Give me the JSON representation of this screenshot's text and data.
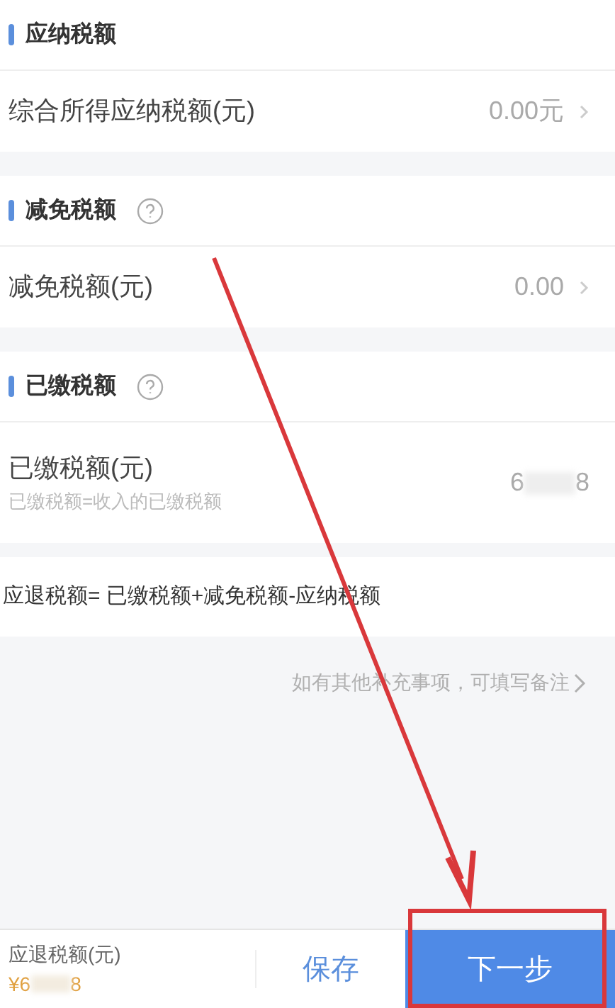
{
  "sections": [
    {
      "title": "应纳税额",
      "help": false,
      "rows": [
        {
          "label": "综合所得应纳税额(元)",
          "value": "0.00元",
          "chevron": true
        }
      ]
    },
    {
      "title": "减免税额",
      "help": true,
      "rows": [
        {
          "label": "减免税额(元)",
          "value": "0.00",
          "chevron": true
        }
      ]
    },
    {
      "title": "已缴税额",
      "help": true,
      "rows": [
        {
          "label": "已缴税额(元)",
          "hint": "已缴税额=收入的已缴税额",
          "value_start": "6",
          "value_end": "8",
          "chevron": false
        }
      ]
    }
  ],
  "formula": "应退税额= 已缴税额+减免税额-应纳税额",
  "note": "如有其他补充事项，可填写备注",
  "footer": {
    "label": "应退税额(元)",
    "amount_start": "¥6",
    "amount_end": "8",
    "save": "保存",
    "next": "下一步"
  }
}
